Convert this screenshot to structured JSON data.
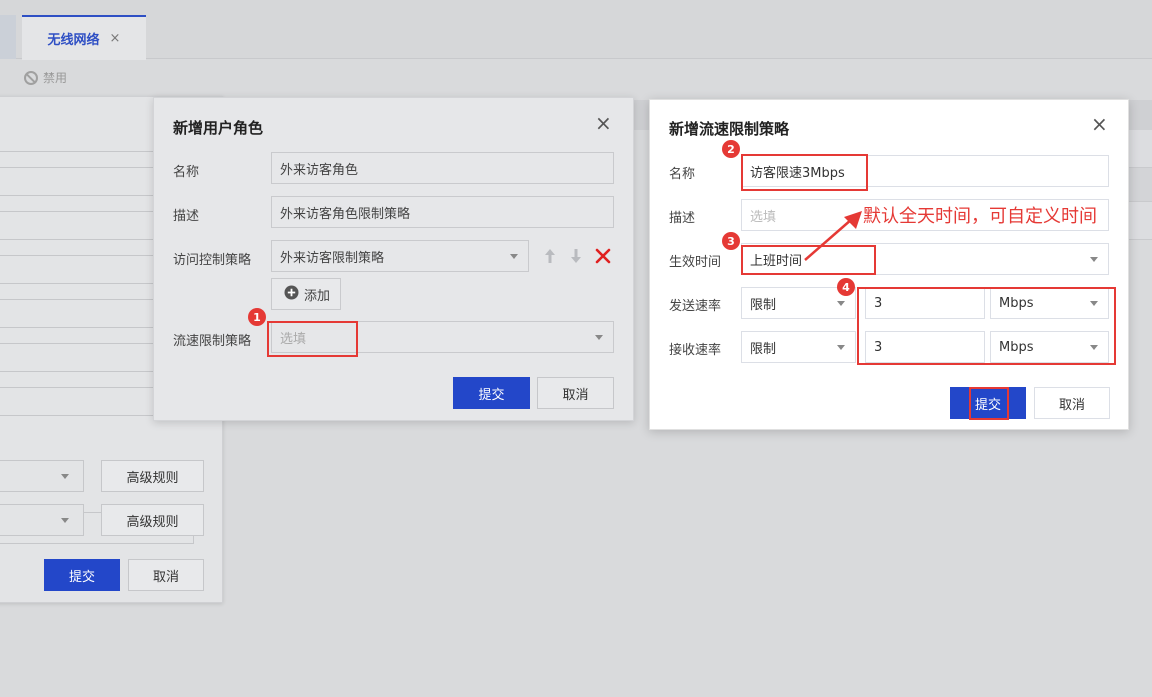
{
  "tab": {
    "label": "无线网络",
    "close": "×"
  },
  "toolbar": {
    "disable_label": "禁用"
  },
  "bg_form": {
    "advanced_rule_1": "高级规则",
    "advanced_rule_2": "高级规则",
    "submit": "提交",
    "cancel": "取消"
  },
  "role_dialog": {
    "title": "新增用户角色",
    "close": "×",
    "name_label": "名称",
    "name_value": "外来访客角色",
    "desc_label": "描述",
    "desc_value": "外来访客角色限制策略",
    "acl_label": "访问控制策略",
    "acl_value": "外来访客限制策略",
    "add_label": "添加",
    "rate_label": "流速限制策略",
    "rate_placeholder": "选填",
    "submit": "提交",
    "cancel": "取消"
  },
  "rate_dialog": {
    "title": "新增流速限制策略",
    "close": "×",
    "name_label": "名称",
    "name_value": "访客限速3Mbps",
    "desc_label": "描述",
    "desc_placeholder": "选填",
    "time_label": "生效时间",
    "time_value": "上班时间",
    "send_label": "发送速率",
    "send_mode": "限制",
    "send_value": "3",
    "send_unit": "Mbps",
    "recv_label": "接收速率",
    "recv_mode": "限制",
    "recv_value": "3",
    "recv_unit": "Mbps",
    "submit": "提交",
    "cancel": "取消"
  },
  "annotations": {
    "badge_1": "1",
    "badge_2": "2",
    "badge_3": "3",
    "badge_4": "4",
    "note": "默认全天时间，可自定义时间",
    "color": "#e53935"
  },
  "colors": {
    "primary": "#2347c9",
    "danger": "#e02020"
  }
}
